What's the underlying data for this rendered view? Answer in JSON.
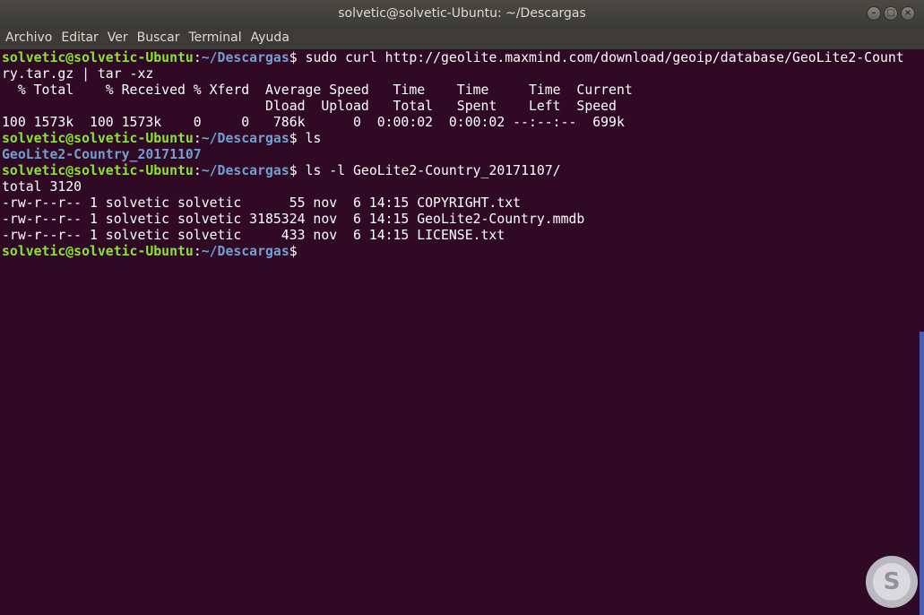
{
  "window": {
    "title": "solvetic@solvetic-Ubuntu: ~/Descargas",
    "controls": {
      "minimize_icon": "minimize-icon",
      "maximize_icon": "maximize-icon",
      "close_icon": "close-icon"
    }
  },
  "menubar": {
    "items": [
      "Archivo",
      "Editar",
      "Ver",
      "Buscar",
      "Terminal",
      "Ayuda"
    ]
  },
  "prompt": {
    "user_host": "solvetic@solvetic-Ubuntu",
    "colon": ":",
    "path": "~/Descargas",
    "dollar": "$"
  },
  "terminal": {
    "cmd1": " sudo curl http://geolite.maxmind.com/download/geoip/database/GeoLite2-Count",
    "cmd1_wrap": "ry.tar.gz | tar -xz",
    "curl_header1": "  % Total    % Received % Xferd  Average Speed   Time    Time     Time  Current",
    "curl_header2": "                                 Dload  Upload   Total   Spent    Left  Speed",
    "curl_progress": "100 1573k  100 1573k    0     0   786k      0  0:00:02  0:00:02 --:--:--  699k",
    "cmd2": " ls",
    "ls_output": "GeoLite2-Country_20171107",
    "cmd3": " ls -l GeoLite2-Country_20171107/",
    "total": "total 3120",
    "files": [
      "-rw-r--r-- 1 solvetic solvetic      55 nov  6 14:15 COPYRIGHT.txt",
      "-rw-r--r-- 1 solvetic solvetic 3185324 nov  6 14:15 GeoLite2-Country.mmdb",
      "-rw-r--r-- 1 solvetic solvetic     433 nov  6 14:15 LICENSE.txt"
    ]
  },
  "colors": {
    "background": "#300a24",
    "prompt_user": "#8ae234",
    "prompt_path": "#729fcf",
    "text": "#ffffff"
  },
  "watermark": {
    "letter": "S"
  }
}
